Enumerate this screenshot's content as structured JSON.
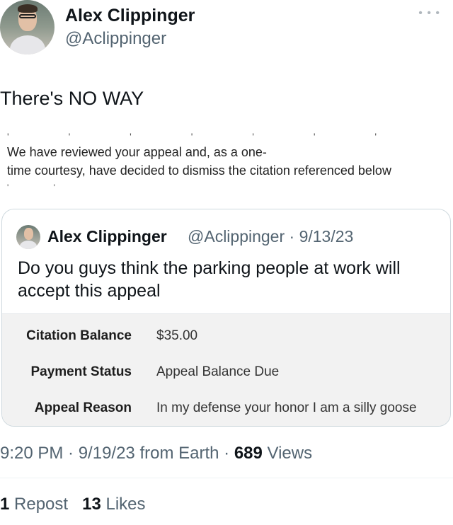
{
  "author": {
    "name": "Alex Clippinger",
    "handle": "@Aclippinger",
    "more_icon": "more-horizontal-icon"
  },
  "tweet": {
    "text": "There's NO WAY"
  },
  "screenshot_text": {
    "line1": "We have reviewed your appeal and, as a one-",
    "line2": "time courtesy, have decided to dismiss the citation referenced below"
  },
  "quoted_tweet": {
    "name": "Alex Clippinger",
    "meta": "@Aclippinger · 9/13/23",
    "text": "Do you guys think the parking people at work will accept this appeal",
    "rows": [
      {
        "label": "Citation Balance",
        "value": "$35.00"
      },
      {
        "label": "Payment Status",
        "value": "Appeal Balance Due"
      },
      {
        "label": "Appeal Reason",
        "value": "In my defense your honor I am a silly goose"
      }
    ]
  },
  "footer": {
    "time": "9:20 PM · 9/19/23 from Earth · ",
    "views_count": "689",
    "views_label": " Views",
    "reposts_count": "1",
    "reposts_label": " Repost",
    "likes_count": "13",
    "likes_label": " Likes"
  },
  "colors": {
    "text": "#0f1419",
    "secondary": "#536471",
    "border": "#cfd9de"
  }
}
